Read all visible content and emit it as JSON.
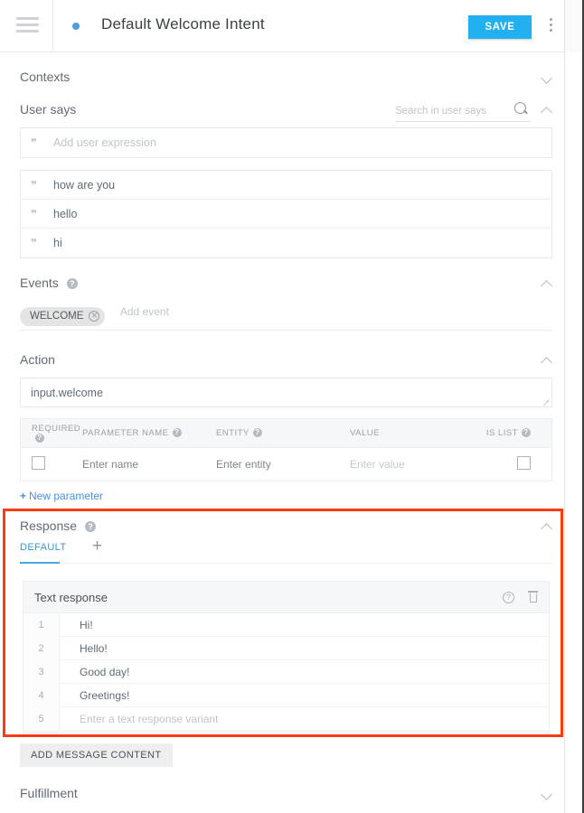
{
  "header": {
    "menu_icon": "hamburger-icon",
    "status_dot_color": "#4a9de0",
    "title": "Default Welcome Intent",
    "save_label": "SAVE",
    "save_color": "#23b0f0",
    "more_icon": "vertical-dots-icon"
  },
  "contexts": {
    "label": "Contexts"
  },
  "user_says": {
    "label": "User says",
    "search_placeholder": "Search in user says",
    "search_value": "",
    "add_placeholder": "Add user expression",
    "expressions": [
      "how are you",
      "hello",
      "hi"
    ]
  },
  "events": {
    "label": "Events",
    "chips": [
      "WELCOME"
    ],
    "add_placeholder": "Add event"
  },
  "action": {
    "label": "Action",
    "value": "input.welcome",
    "table": {
      "columns": [
        "REQUIRED",
        "PARAMETER NAME",
        "ENTITY",
        "VALUE",
        "IS LIST"
      ],
      "rows": [
        {
          "required": false,
          "name": "Enter name",
          "entity": "Enter entity",
          "value": "Enter value",
          "is_list": false
        }
      ]
    },
    "new_parameter_label": "New parameter"
  },
  "response": {
    "label": "Response",
    "highlight_color": "#fa3c10",
    "tabs": [
      {
        "label": "DEFAULT",
        "active": true
      }
    ],
    "add_tab_icon": "plus-icon",
    "card": {
      "title": "Text response",
      "help_icon": "help-circle-icon",
      "delete_icon": "trash-icon",
      "lines": [
        {
          "num": "1",
          "text": "Hi!",
          "placeholder": false
        },
        {
          "num": "2",
          "text": "Hello!",
          "placeholder": false
        },
        {
          "num": "3",
          "text": "Good day!",
          "placeholder": false
        },
        {
          "num": "4",
          "text": "Greetings!",
          "placeholder": false
        },
        {
          "num": "5",
          "text": "Enter a text response variant",
          "placeholder": true
        }
      ]
    },
    "add_message_label": "ADD MESSAGE CONTENT"
  },
  "fulfillment": {
    "label": "Fulfillment"
  }
}
